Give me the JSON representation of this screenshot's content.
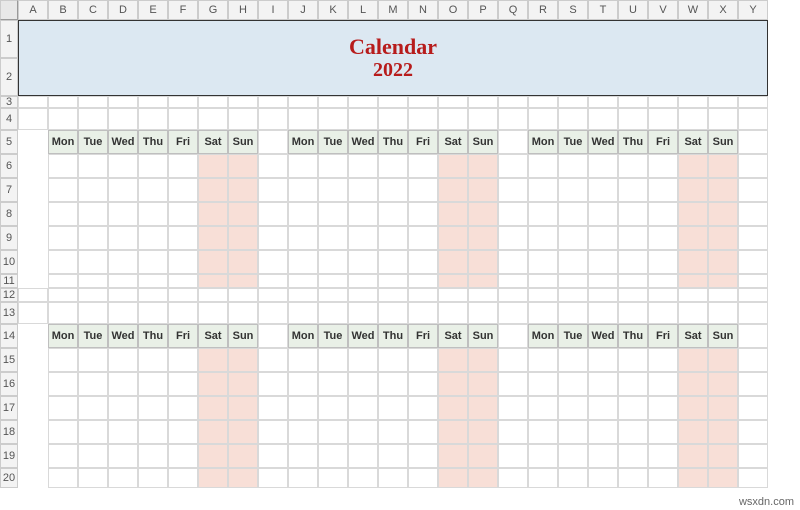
{
  "columns": [
    "A",
    "B",
    "C",
    "D",
    "E",
    "F",
    "G",
    "H",
    "I",
    "J",
    "K",
    "L",
    "M",
    "N",
    "O",
    "P",
    "Q",
    "R",
    "S",
    "T",
    "U",
    "V",
    "W",
    "X",
    "Y"
  ],
  "rows": [
    "1",
    "2",
    "3",
    "4",
    "5",
    "6",
    "7",
    "8",
    "9",
    "10",
    "11",
    "12",
    "13",
    "14",
    "15",
    "16",
    "17",
    "18",
    "19",
    "20"
  ],
  "title": {
    "line1": "Calendar",
    "line2": "2022"
  },
  "days": [
    "Mon",
    "Tue",
    "Wed",
    "Thu",
    "Fri",
    "Sat",
    "Sun"
  ],
  "month_blocks": {
    "col_starts": [
      2,
      10,
      18
    ],
    "header_rows": [
      5,
      14
    ],
    "body_rows": [
      [
        6,
        7,
        8,
        9,
        10,
        11
      ],
      [
        15,
        16,
        17,
        18,
        19,
        20
      ]
    ],
    "weekend_day_indexes": [
      5,
      6
    ]
  },
  "watermark": "wsxdn.com"
}
